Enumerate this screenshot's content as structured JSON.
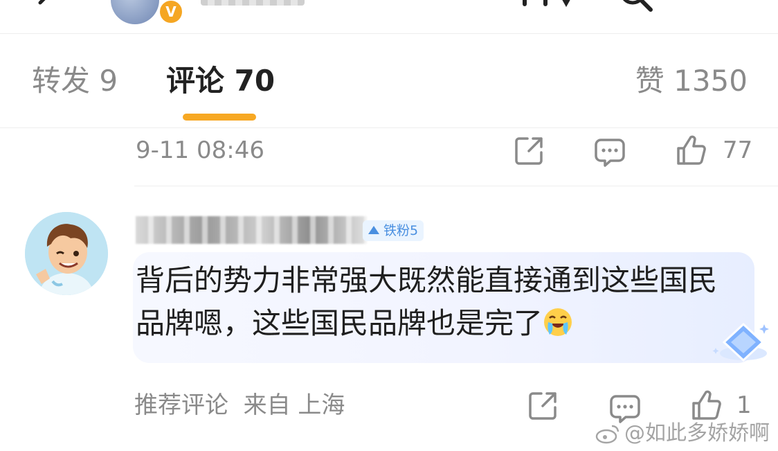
{
  "header": {
    "back_icon": "back-arrow-icon",
    "more_icon": "more-icon",
    "search_icon": "search-icon",
    "vip_badge": "V"
  },
  "tabs": {
    "repost": "转发 9",
    "comment": "评论 70",
    "like": "赞 1350",
    "active": "comment",
    "indicator_color": "#f7a823"
  },
  "comment1": {
    "time": "9-11 08:46",
    "share_icon": "share-icon",
    "reply_icon": "comment-icon",
    "like_icon": "thumbs-up-icon",
    "like_count": "77"
  },
  "comment2": {
    "fan_badge": "铁粉5",
    "text": "背后的势力非常强大既然能直接通到这些国民品牌嗯，这些国民品牌也是完了",
    "emoji": "tears-of-joy-emoji",
    "footer_label": "推荐评论  来自 上海",
    "share_icon": "share-icon",
    "reply_icon": "comment-icon",
    "like_icon": "thumbs-up-icon",
    "like_count": "1"
  },
  "watermark": "@如此多娇娇啊",
  "colors": {
    "accent": "#f7a823",
    "muted_text": "#8a8a8a",
    "fan_badge": "#4a8fe0",
    "bubble": "#f2f4ff"
  }
}
